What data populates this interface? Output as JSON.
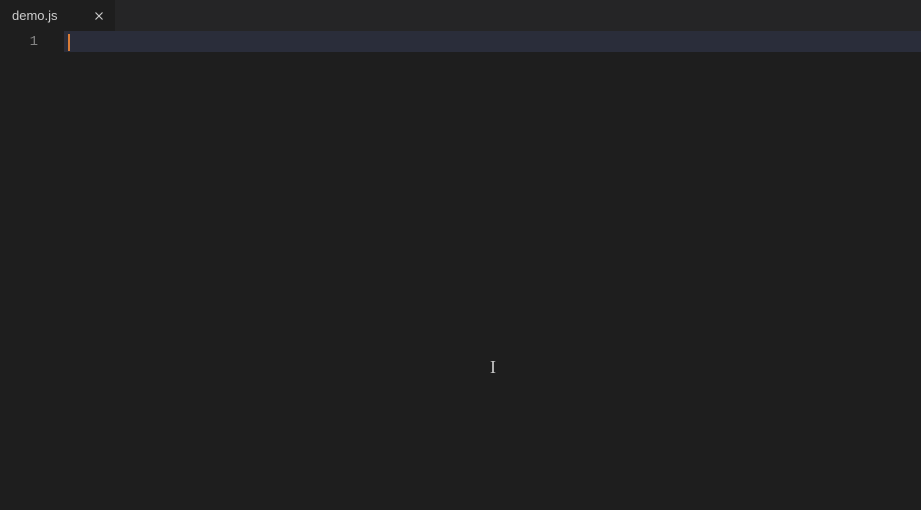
{
  "tabs": [
    {
      "label": "demo.js",
      "active": true
    }
  ],
  "editor": {
    "line_numbers": [
      "1"
    ],
    "content": "",
    "cursor_color": "#d97c37"
  }
}
